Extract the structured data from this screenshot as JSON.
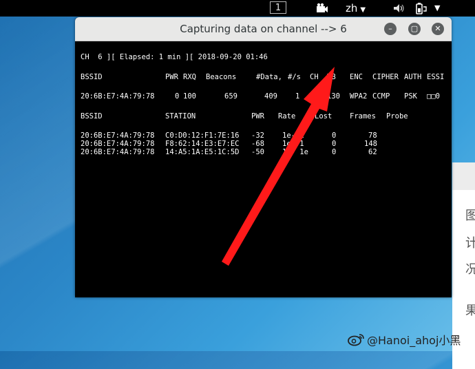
{
  "topbar": {
    "workspace": "1",
    "language": "zh",
    "icons": [
      "camera-icon",
      "volume-icon",
      "power-battery-icon",
      "chevron-down-icon"
    ]
  },
  "window": {
    "title": "Capturing data on channel --> 6",
    "buttons": [
      "minimize-icon",
      "maximize-icon",
      "close-icon"
    ]
  },
  "terminal": {
    "status": "CH  6 ][ Elapsed: 1 min ][ 2018-09-20 01:46",
    "ap_header": {
      "bssid": "BSSID",
      "pwr": "PWR",
      "rxq": "RXQ",
      "beacons": "Beacons",
      "data": "#Data,",
      "rate": "#/s",
      "ch": "CH",
      "mb": "MB",
      "enc": "ENC",
      "cipher": "CIPHER",
      "auth": "AUTH",
      "essid": "ESSI"
    },
    "ap_rows": [
      {
        "bssid": "20:6B:E7:4A:79:78",
        "pwr": "0",
        "rxq": "100",
        "beacons": "659",
        "data": "409",
        "rate": "1",
        "ch": "6",
        "mb": "130",
        "enc": "WPA2",
        "cipher": "CCMP",
        "auth": "PSK",
        "essid": "□□0"
      }
    ],
    "station_header": {
      "bssid": "BSSID",
      "station": "STATION",
      "pwr": "PWR",
      "rate": "Rate",
      "lost": "Lost",
      "frames": "Frames",
      "probe": "Probe"
    },
    "station_rows": [
      {
        "bssid": "20:6B:E7:4A:79:78",
        "station": "C0:D0:12:F1:7E:16",
        "pwr": "-32",
        "rate": "1e- 1",
        "lost": "0",
        "frames": "78"
      },
      {
        "bssid": "20:6B:E7:4A:79:78",
        "station": "F8:62:14:E3:E7:EC",
        "pwr": "-68",
        "rate": "1e- 1",
        "lost": "0",
        "frames": "148"
      },
      {
        "bssid": "20:6B:E7:4A:79:78",
        "station": "14:A5:1A:E5:1C:5D",
        "pwr": "-50",
        "rate": "1e- 1e",
        "lost": "0",
        "frames": "62"
      }
    ]
  },
  "annotation": {
    "arrow_color": "#ff1a1a"
  },
  "side_window_chars": [
    "图",
    "计",
    "况",
    "果"
  ],
  "watermark": "@Hanoi_ahoj小黑"
}
